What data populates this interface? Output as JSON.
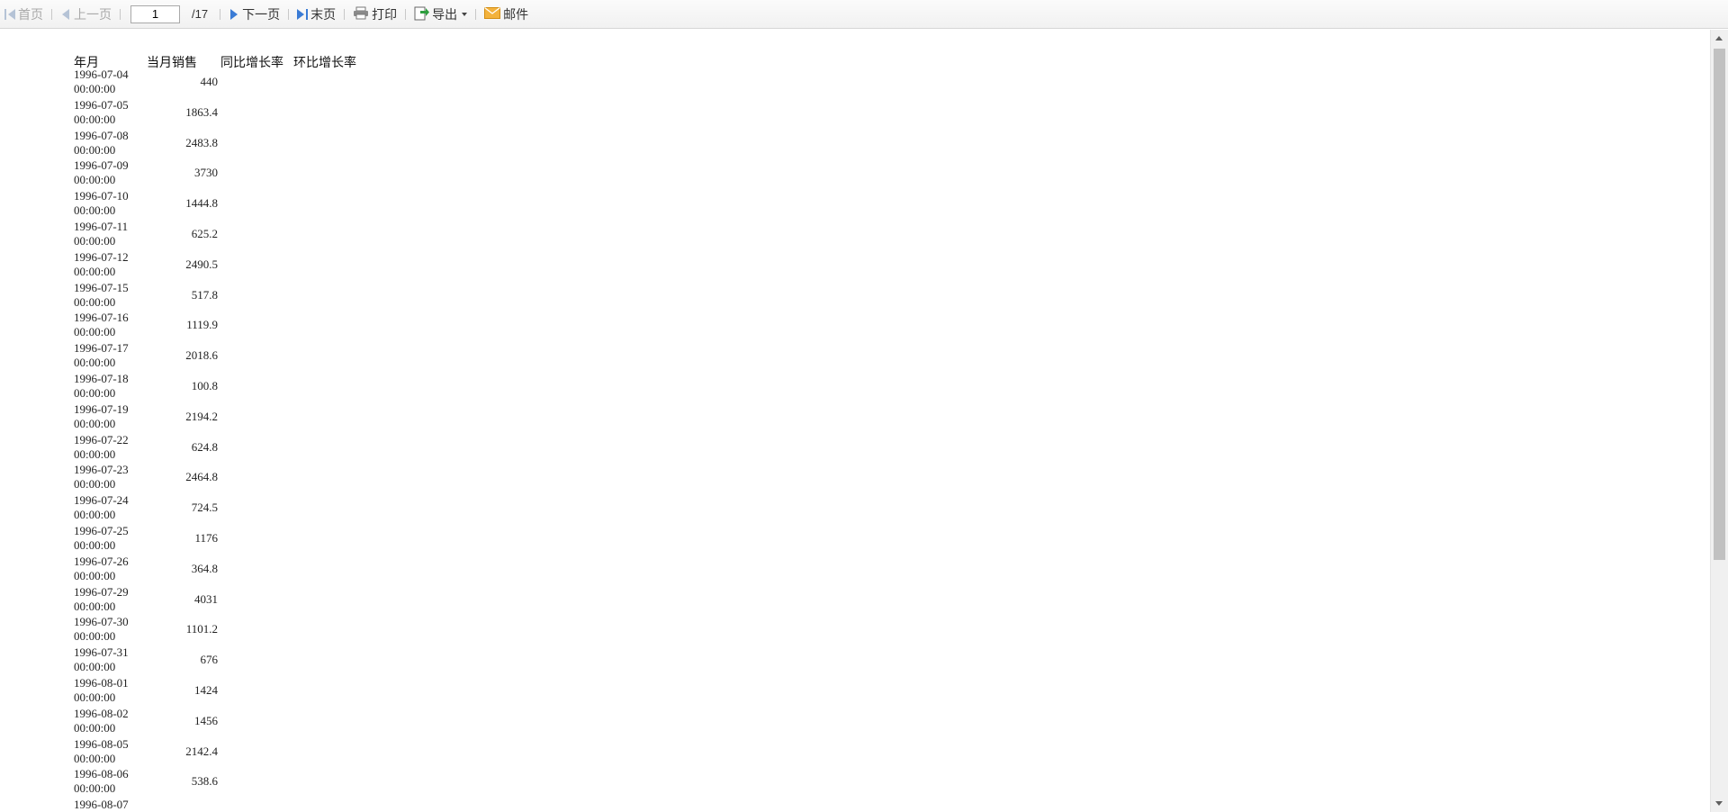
{
  "toolbar": {
    "first_label": "首页",
    "prev_label": "上一页",
    "page_value": "1",
    "page_total": "/17",
    "next_label": "下一页",
    "last_label": "末页",
    "print_label": "打印",
    "export_label": "导出",
    "mail_label": "邮件"
  },
  "report": {
    "headers": [
      "年月",
      "当月销售",
      "同比增长率",
      "环比增长率"
    ],
    "rows": [
      {
        "date": "1996-07-04",
        "time": "00:00:00",
        "value": "440"
      },
      {
        "date": "1996-07-05",
        "time": "00:00:00",
        "value": "1863.4"
      },
      {
        "date": "1996-07-08",
        "time": "00:00:00",
        "value": "2483.8"
      },
      {
        "date": "1996-07-09",
        "time": "00:00:00",
        "value": "3730"
      },
      {
        "date": "1996-07-10",
        "time": "00:00:00",
        "value": "1444.8"
      },
      {
        "date": "1996-07-11",
        "time": "00:00:00",
        "value": "625.2"
      },
      {
        "date": "1996-07-12",
        "time": "00:00:00",
        "value": "2490.5"
      },
      {
        "date": "1996-07-15",
        "time": "00:00:00",
        "value": "517.8"
      },
      {
        "date": "1996-07-16",
        "time": "00:00:00",
        "value": "1119.9"
      },
      {
        "date": "1996-07-17",
        "time": "00:00:00",
        "value": "2018.6"
      },
      {
        "date": "1996-07-18",
        "time": "00:00:00",
        "value": "100.8"
      },
      {
        "date": "1996-07-19",
        "time": "00:00:00",
        "value": "2194.2"
      },
      {
        "date": "1996-07-22",
        "time": "00:00:00",
        "value": "624.8"
      },
      {
        "date": "1996-07-23",
        "time": "00:00:00",
        "value": "2464.8"
      },
      {
        "date": "1996-07-24",
        "time": "00:00:00",
        "value": "724.5"
      },
      {
        "date": "1996-07-25",
        "time": "00:00:00",
        "value": "1176"
      },
      {
        "date": "1996-07-26",
        "time": "00:00:00",
        "value": "364.8"
      },
      {
        "date": "1996-07-29",
        "time": "00:00:00",
        "value": "4031"
      },
      {
        "date": "1996-07-30",
        "time": "00:00:00",
        "value": "1101.2"
      },
      {
        "date": "1996-07-31",
        "time": "00:00:00",
        "value": "676"
      },
      {
        "date": "1996-08-01",
        "time": "00:00:00",
        "value": "1424"
      },
      {
        "date": "1996-08-02",
        "time": "00:00:00",
        "value": "1456"
      },
      {
        "date": "1996-08-05",
        "time": "00:00:00",
        "value": "2142.4"
      },
      {
        "date": "1996-08-06",
        "time": "00:00:00",
        "value": "538.6"
      },
      {
        "date": "1996-08-07",
        "time": "",
        "value": ""
      }
    ]
  }
}
